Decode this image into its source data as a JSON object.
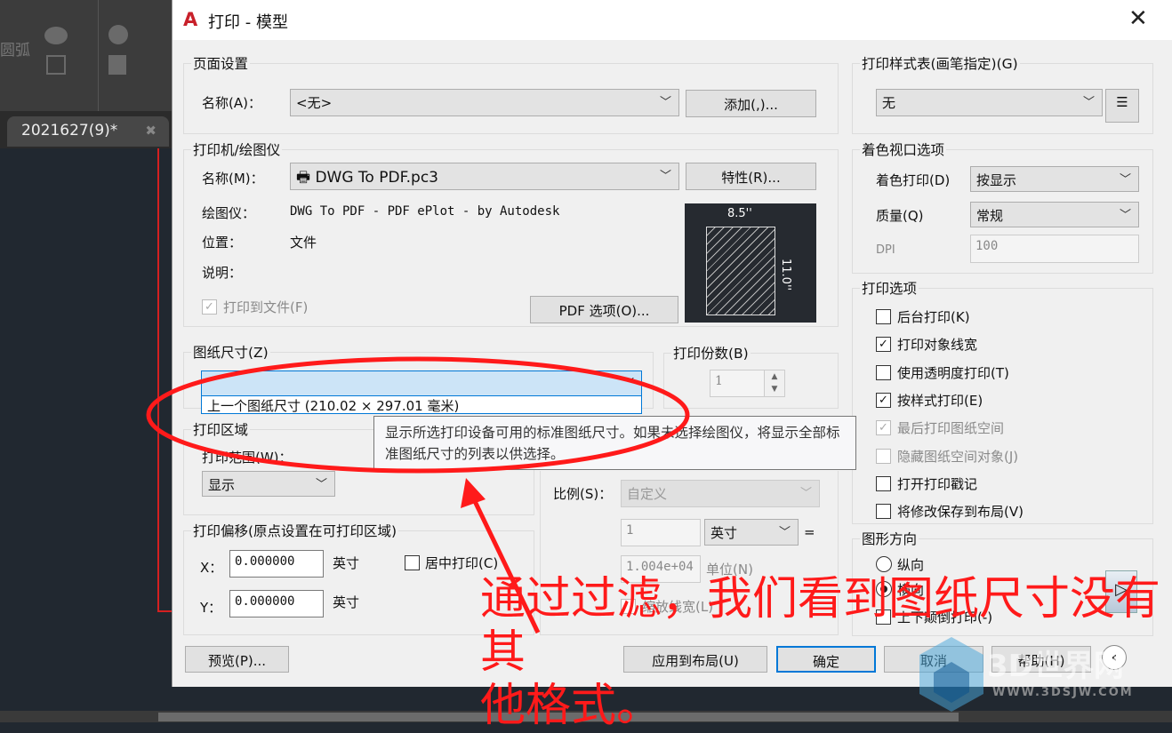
{
  "app": {
    "doc_tab": "2021627(9)*",
    "partial_ribbon_text": "圆弧"
  },
  "dialog": {
    "title": "打印 - 模型",
    "close": "✕"
  },
  "page_setup": {
    "group": "页面设置",
    "name_label": "名称(A)：",
    "name_value": "<无>",
    "add_button": "添加(,)..."
  },
  "printer": {
    "group": "打印机/绘图仪",
    "name_label": "名称(M)：",
    "name_value": "DWG To PDF.pc3",
    "properties_button": "特性(R)...",
    "plotter_label": "绘图仪：",
    "plotter_value": "DWG To PDF - PDF ePlot - by Autodesk",
    "location_label": "位置：",
    "location_value": "文件",
    "desc_label": "说明：",
    "plot_to_file": "打印到文件(F)",
    "plot_to_file_checked": true,
    "pdf_options_button": "PDF 选项(O)...",
    "preview_width": "8.5''",
    "preview_height": "11.0''"
  },
  "paper_size": {
    "group": "图纸尺寸(Z)",
    "value": "",
    "dropdown_item": "上一个图纸尺寸  (210.02 × 297.01 毫米)"
  },
  "copies": {
    "group": "打印份数(B)",
    "value": "1"
  },
  "plot_area": {
    "group": "打印区域",
    "range_label": "打印范围(W)：",
    "range_value": "显示"
  },
  "tooltip": "显示所选打印设备可用的标准图纸尺寸。如果未选择绘图仪，将显示全部标准图纸尺寸的列表以供选择。",
  "scale": {
    "label": "比例(S)：",
    "value": "自定义",
    "inches_value": "1",
    "unit_value": "英寸",
    "equals": "=",
    "units_value": "1.004e+04",
    "units_label": "单位(N)",
    "lineweights": "缩放线宽(L)"
  },
  "offset": {
    "group": "打印偏移(原点设置在可打印区域)",
    "x_label": "X：",
    "x_value": "0.000000",
    "x_unit": "英寸",
    "y_label": "Y：",
    "y_value": "0.000000",
    "y_unit": "英寸",
    "center": "居中打印(C)"
  },
  "style_table": {
    "group": "打印样式表(画笔指定)(G)",
    "value": "无"
  },
  "shaded": {
    "group": "着色视口选项",
    "shade_label": "着色打印(D)",
    "shade_value": "按显示",
    "quality_label": "质量(Q)",
    "quality_value": "常规",
    "dpi_label": "DPI",
    "dpi_value": "100"
  },
  "options": {
    "group": "打印选项",
    "items": [
      {
        "label": "后台打印(K)",
        "checked": false,
        "disabled": false
      },
      {
        "label": "打印对象线宽",
        "checked": true,
        "disabled": false
      },
      {
        "label": "使用透明度打印(T)",
        "checked": false,
        "disabled": false
      },
      {
        "label": "按样式打印(E)",
        "checked": true,
        "disabled": false
      },
      {
        "label": "最后打印图纸空间",
        "checked": true,
        "disabled": true
      },
      {
        "label": "隐藏图纸空间对象(J)",
        "checked": false,
        "disabled": true
      },
      {
        "label": "打开打印戳记",
        "checked": false,
        "disabled": false
      },
      {
        "label": "将修改保存到布局(V)",
        "checked": false,
        "disabled": false
      }
    ]
  },
  "orientation": {
    "group": "图形方向",
    "portrait": "纵向",
    "landscape": "横向",
    "selected": "landscape",
    "upside_down": "上下颠倒打印(-)"
  },
  "buttons": {
    "preview": "预览(P)...",
    "apply": "应用到布局(U)",
    "ok": "确定",
    "cancel": "取消",
    "help": "帮助(H)"
  },
  "annotation": {
    "line1": "通过过滤，我们看到图纸尺寸没有其",
    "line2": "他格式。",
    "color": "#ff1a1a"
  },
  "watermark": {
    "brand": "3D世界网",
    "url": "WWW.3DSJW.COM"
  }
}
